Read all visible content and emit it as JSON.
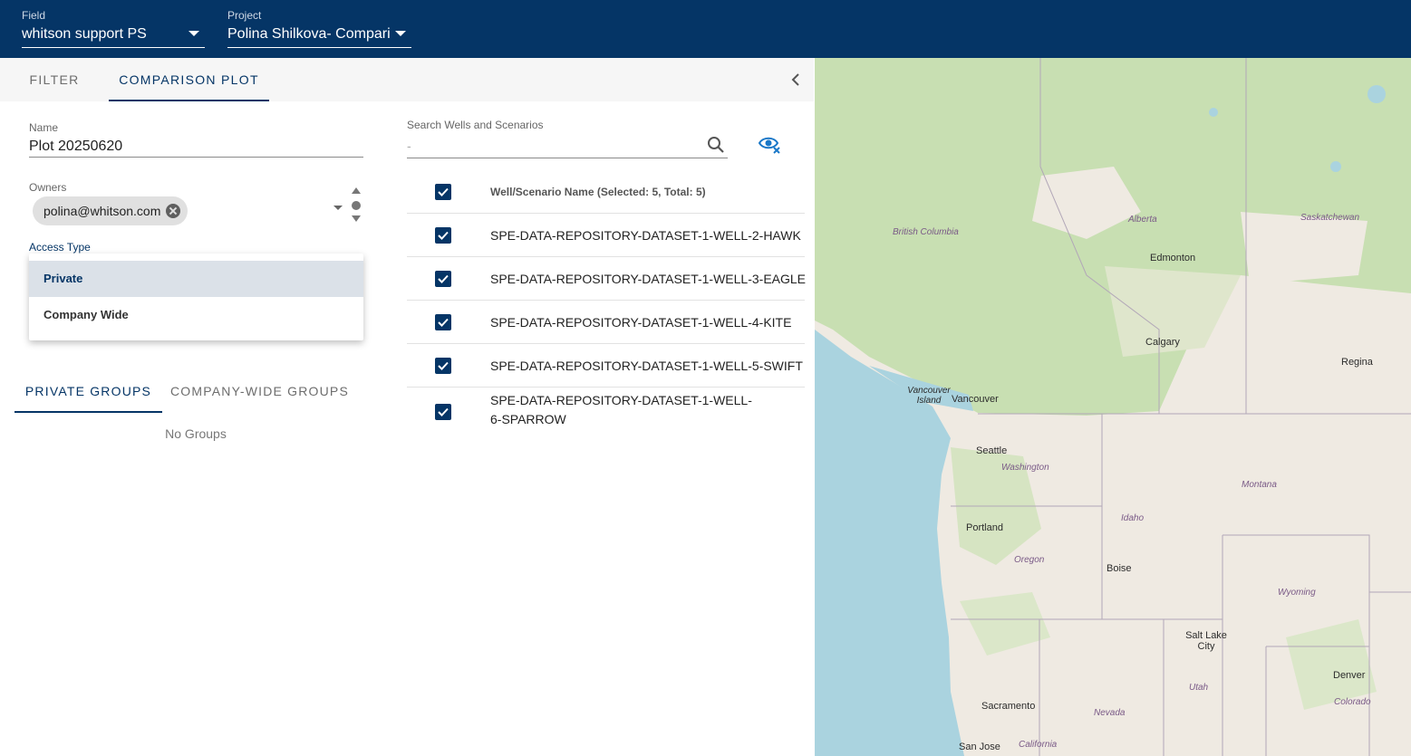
{
  "header": {
    "field_label": "Field",
    "field_value": "whitson support PS",
    "project_label": "Project",
    "project_value": "Polina Shilkova- Compari"
  },
  "tabs": [
    {
      "label": "FILTER"
    },
    {
      "label": "COMPARISON PLOT"
    }
  ],
  "form": {
    "name_label": "Name",
    "name_value": "Plot 20250620",
    "owners_label": "Owners",
    "owner_chip": "polina@whitson.com",
    "access_label": "Access Type",
    "access_options": [
      "Private",
      "Company Wide"
    ],
    "access_selected": "Private"
  },
  "groups": {
    "tabs": [
      "PRIVATE GROUPS",
      "COMPANY-WIDE GROUPS"
    ],
    "empty_text": "No Groups"
  },
  "search": {
    "label": "Search Wells and Scenarios",
    "placeholder": "-"
  },
  "wells": {
    "header": "Well/Scenario Name (Selected: 5, Total: 5)",
    "rows": [
      "SPE-DATA-REPOSITORY-DATASET-1-WELL-2-HAWK",
      "SPE-DATA-REPOSITORY-DATASET-1-WELL-3-EAGLE",
      "SPE-DATA-REPOSITORY-DATASET-1-WELL-4-KITE",
      "SPE-DATA-REPOSITORY-DATASET-1-WELL-5-SWIFT",
      "SPE-DATA-REPOSITORY-DATASET-1-WELL-6-SPARROW"
    ]
  },
  "map": {
    "regions": [
      "British Columbia",
      "Alberta",
      "Saskatchewan",
      "Washington",
      "Montana",
      "Idaho",
      "Oregon",
      "Wyoming",
      "Utah",
      "Nevada",
      "Colorado",
      "California"
    ],
    "cities": [
      "Edmonton",
      "Calgary",
      "Regina",
      "Vancouver Island",
      "Vancouver",
      "Seattle",
      "Portland",
      "Boise",
      "Salt Lake City",
      "Denver",
      "Sacramento",
      "San Jose"
    ]
  },
  "colors": {
    "primary": "#053566",
    "map_water": "#aad3df",
    "map_forest": "#c8dfb2",
    "map_land": "#efeae2"
  },
  "icons": [
    "chevron-down-icon",
    "chevron-left-icon",
    "close-icon",
    "search-icon",
    "visibility-off-icon",
    "check-icon"
  ]
}
